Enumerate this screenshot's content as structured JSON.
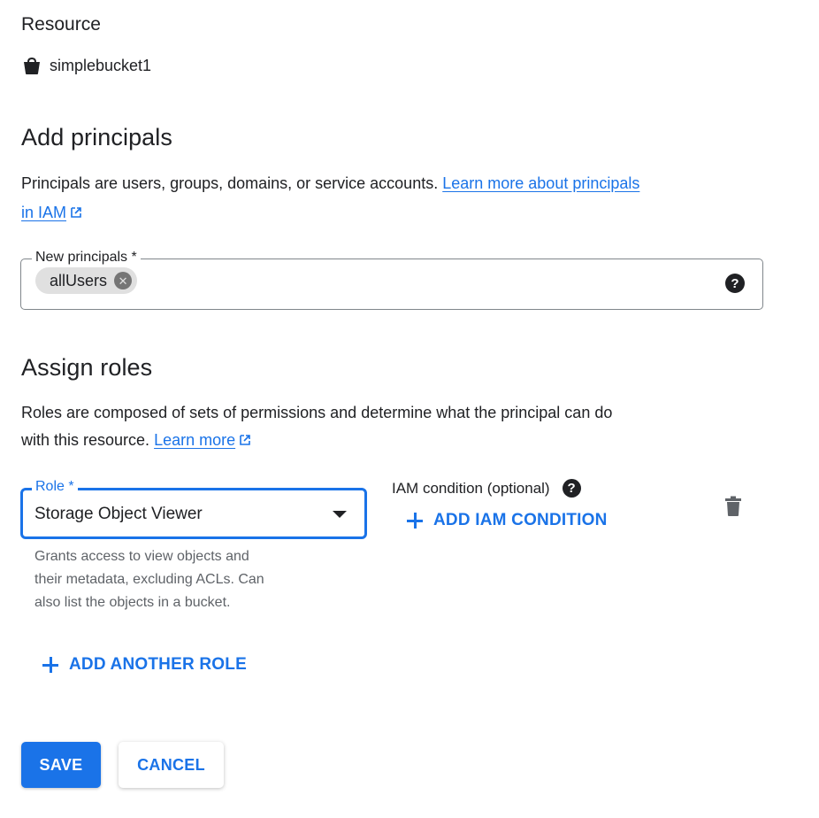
{
  "resource": {
    "heading": "Resource",
    "icon": "bucket-icon",
    "bucket_name": "simplebucket1"
  },
  "add_principals": {
    "heading": "Add principals",
    "description": "Principals are users, groups, domains, or service accounts.",
    "link_text_line1": "Learn more about principals",
    "link_text_line2": "in IAM",
    "field_label": "New principals *",
    "chips": [
      "allUsers"
    ],
    "help_icon": "help-icon"
  },
  "assign_roles": {
    "heading": "Assign roles",
    "description_line1": "Roles are composed of sets of permissions and determine what the principal can do",
    "description_line2": "with this resource.",
    "link_text": "Learn more",
    "role_label": "Role *",
    "role_value": "Storage Object Viewer",
    "role_hint_line1": "Grants access to view objects and",
    "role_hint_line2": "their metadata, excluding ACLs. Can",
    "role_hint_line3": "also list the objects in a bucket.",
    "iam_condition_label": "IAM condition (optional)",
    "add_condition_label": "ADD IAM CONDITION",
    "add_another_role_label": "ADD ANOTHER ROLE",
    "delete_icon": "trash-icon"
  },
  "actions": {
    "save_label": "SAVE",
    "cancel_label": "CANCEL"
  },
  "colors": {
    "accent": "#1a73e8",
    "text": "#202124",
    "hint": "#5f6368",
    "chip_bg": "#e0e0e0"
  }
}
